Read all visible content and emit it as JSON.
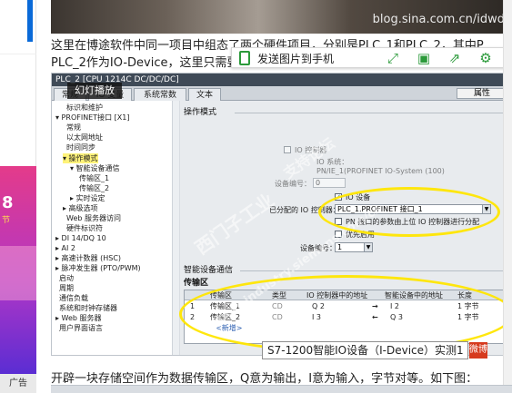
{
  "left_sidebar": {
    "ad": {
      "number": "8",
      "subtext": "节",
      "label": "广告"
    }
  },
  "article": {
    "photo_watermark": "blog.sina.com.cn/idwd",
    "para1_line1": "这里在博途软件中同一项目中组态了两个硬件项目，分别是PLC_1和PLC_2，其中P",
    "para1_line2": "PLC_2作为IO-Device，这里只需要在P",
    "para2": "开辟一块存储空间作为数据传输区，Q意为输出，I意为输入，字节对等。如下图："
  },
  "overlay_toolbar": {
    "send_label": "发送图片到手机",
    "icons": [
      "expand-icon",
      "save-icon",
      "share-icon",
      "settings-icon"
    ]
  },
  "slideshow_label": "幻灯播放",
  "tia": {
    "title": "PLC_2 [CPU 1214C DC/DC/DC]",
    "tabs": [
      "常规",
      "IO 变量",
      "系统常数",
      "文本"
    ],
    "properties_tab": "属性",
    "tree": [
      "标识和维护",
      "▾ PROFINET接口 [X1]",
      "常规",
      "以太网地址",
      "时间同步",
      "▾ 操作模式",
      "▾ 智能设备通信",
      "传输区_1",
      "传输区_2",
      "▸ 实时设定",
      "▸ 高级选项",
      "Web 服务器访问",
      "硬件标识符",
      "▸ DI 14/DQ 10",
      "▸ AI 2",
      "▸ 高速计数器 (HSC)",
      "▸ 脉冲发生器 (PTO/PWM)",
      "启动",
      "周期",
      "通信负载",
      "系统和时钟存储器",
      "▸ Web 服务器",
      "用户界面语言"
    ],
    "op_mode": {
      "header": "操作模式",
      "io_controller_chk": "IO 控制器",
      "io_system_lbl": "IO 系统：",
      "io_system_val": "PN/IE_1(PROFINET IO-System (100)",
      "device_no_lbl": "设备编号：",
      "device_no_val": "0",
      "io_device_chk": "IO 设备",
      "assigned_ctrl_lbl": "已分配的 IO 控制器：",
      "assigned_ctrl_val": "PLC_1.PROFINET 接口_1",
      "pn_param_chk": "PN 接口的参数由上位 IO 控制器进行分配",
      "priority_chk": "优先启用",
      "device_no2_lbl": "设备编号：",
      "device_no2_val": "1"
    },
    "idevice_header": "智能设备通信",
    "xfer_header": "传输区",
    "xfer_columns": [
      "",
      "传输区",
      "类型",
      "IO 控制器中的地址",
      "",
      "智能设备中的地址",
      "长度"
    ],
    "xfer_rows": [
      {
        "idx": "1",
        "name": "传输区_1",
        "type": "CD",
        "ctrl_addr": "Q 2",
        "arrow": "→",
        "dev_addr": "I 2",
        "len": "1 字节"
      },
      {
        "idx": "2",
        "name": "传输区_2",
        "type": "CD",
        "ctrl_addr": "I 3",
        "arrow": "←",
        "dev_addr": "Q 3",
        "len": "1 字节"
      }
    ],
    "xfer_add": "<新增>",
    "watermarks": [
      "西门子工业",
      "支持论坛",
      "support.industry.siemens.com/cs"
    ]
  },
  "caption": {
    "text": "S7-1200智能IO设备（I-Device）实测1",
    "tag": "微博"
  },
  "colors": {
    "highlight": "#ffe600",
    "toolbar_green": "#2b9a3a",
    "ad_gradient_start": "#e43b8a",
    "ad_gradient_end": "#5a2dd3"
  }
}
